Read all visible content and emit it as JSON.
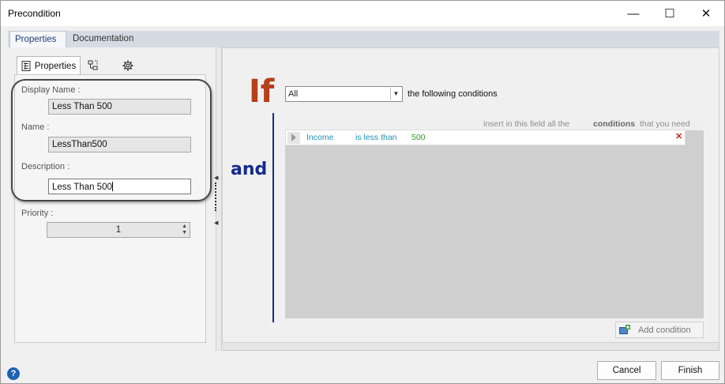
{
  "window": {
    "title": "Precondition",
    "minimize_glyph": "—",
    "maximize_glyph": "☐",
    "close_glyph": "✕"
  },
  "tabs": [
    {
      "label": "Properties",
      "active": true
    },
    {
      "label": "Documentation",
      "active": false
    }
  ],
  "left_panel": {
    "subtabs": [
      {
        "label": "Properties",
        "icon": "properties-grid-icon",
        "active": true
      },
      {
        "label": "",
        "icon": "structure-icon",
        "active": false
      },
      {
        "label": "",
        "icon": "settings-gear-icon",
        "active": false
      }
    ],
    "fields": {
      "display_name_label": "Display Name :",
      "display_name_value": "Less Than 500",
      "name_label": "Name :",
      "name_value": "LessThan500",
      "description_label": "Description :",
      "description_value": "Less Than 500",
      "priority_label": "Priority :",
      "priority_value": "1"
    }
  },
  "rule": {
    "if_label": "If",
    "and_label": "and",
    "quantifier_selected": "All",
    "quantifier_suffix": "the following conditions",
    "hint_part1": "insert in this field all the",
    "hint_bold": "conditions",
    "hint_part2": "that you need",
    "conditions": [
      {
        "field": "Income",
        "operator": "is less than",
        "value": "500"
      }
    ],
    "delete_glyph": "✕",
    "add_condition_label": "Add condition"
  },
  "footer": {
    "help_glyph": "?",
    "cancel_label": "Cancel",
    "finish_label": "Finish"
  },
  "colors": {
    "if_color": "#b5401a",
    "and_color": "#162a8c",
    "field_token": "#1e8fb9",
    "value_token": "#2e9a2e",
    "delete_color": "#d71c1c"
  }
}
